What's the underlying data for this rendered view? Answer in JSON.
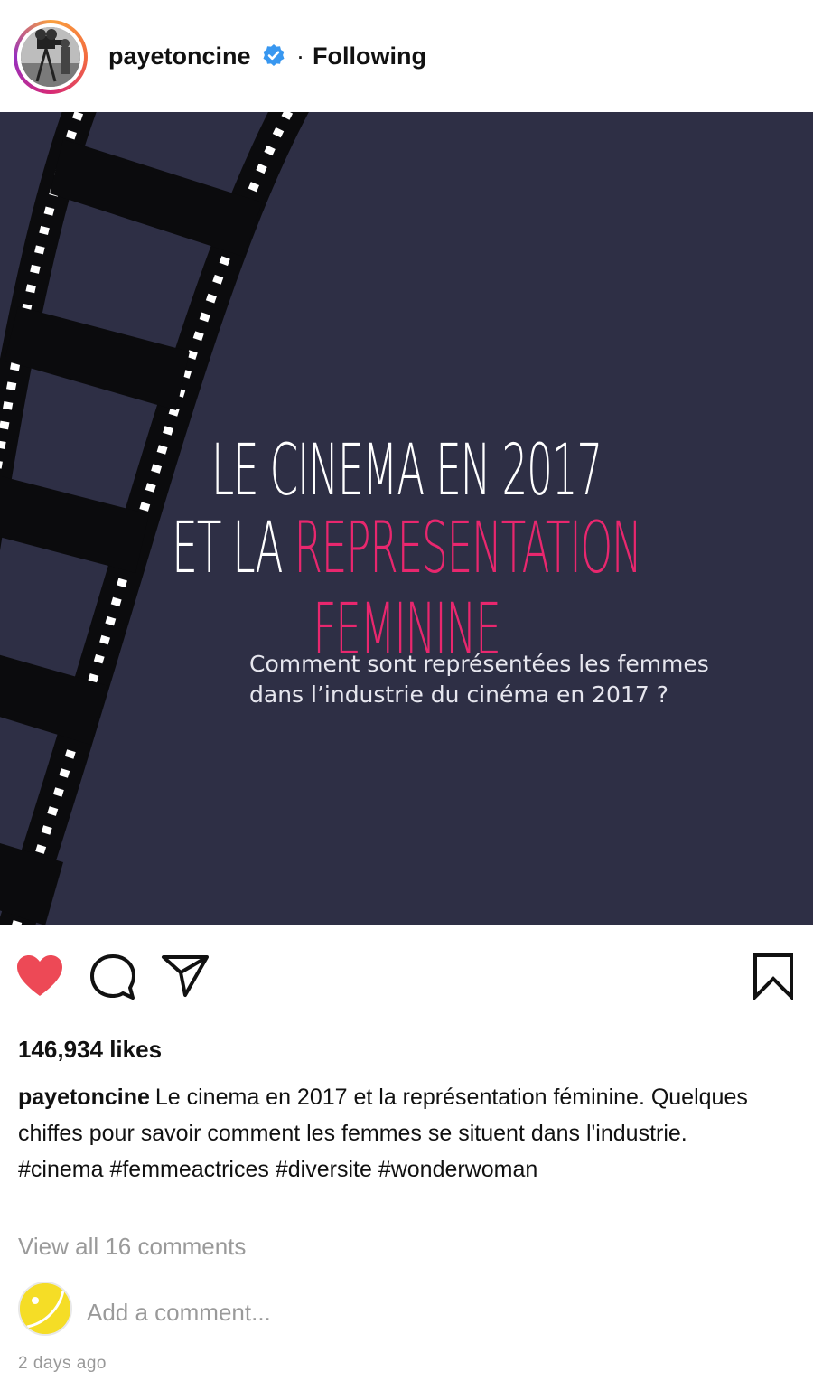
{
  "header": {
    "username": "payetoncine",
    "separator": "·",
    "follow_status": "Following"
  },
  "post": {
    "title_line1": "LE CINEMA EN 2017",
    "title_line2_prefix": "ET LA ",
    "title_line2_accent": "REPRESENTATION FEMININE",
    "subtitle_line1": "Comment sont représentées les femmes",
    "subtitle_line2": "dans l’industrie du cinéma en 2017 ?",
    "colors": {
      "background": "#2e2f45",
      "accent": "#e8276e",
      "like": "#ed4956"
    }
  },
  "actions": {
    "like_icon": "heart-icon",
    "comment_icon": "comment-icon",
    "share_icon": "paper-plane-icon",
    "save_icon": "bookmark-icon",
    "liked": true
  },
  "likes": "146,934 likes",
  "caption": {
    "username": "payetoncine",
    "text": "Le cinema en 2017 et la représentation féminine. Quelques chiffes pour savoir comment les femmes se situent dans l'industrie.",
    "hashtags": [
      "#cinema",
      "#femmeactrices",
      "#diversite",
      "#wonderwoman"
    ]
  },
  "view_all_comments": "View all 16 comments",
  "comment_box": {
    "placeholder": "Add a comment..."
  },
  "timestamp": "2 days ago"
}
